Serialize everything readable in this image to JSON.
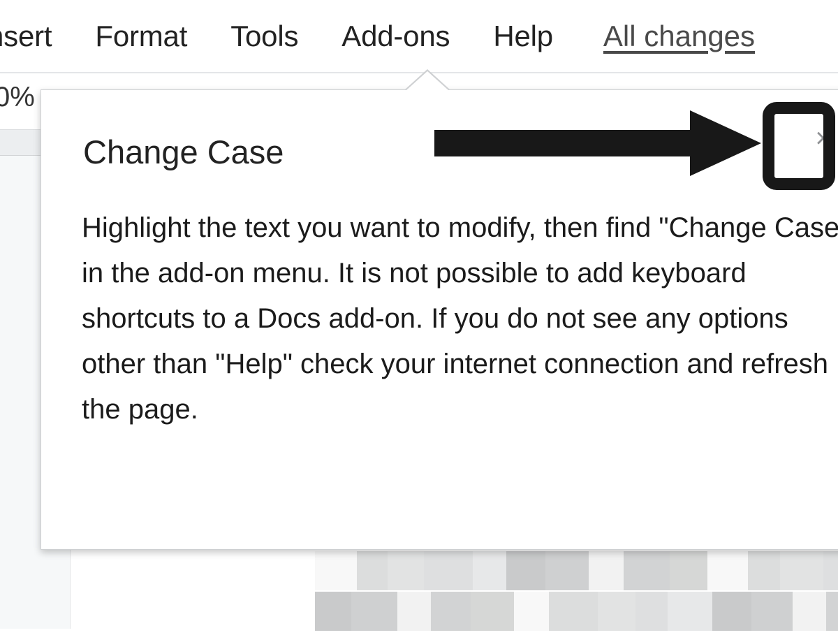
{
  "app": {
    "menu_bar": {
      "items": [
        {
          "label": "nsert",
          "name": "menu-insert"
        },
        {
          "label": "Format",
          "name": "menu-format"
        },
        {
          "label": "Tools",
          "name": "menu-tools"
        },
        {
          "label": "Add-ons",
          "name": "menu-addons"
        },
        {
          "label": "Help",
          "name": "menu-help"
        }
      ],
      "save_status": "All changes"
    },
    "toolbar": {
      "zoom_level": "0%"
    }
  },
  "dialog": {
    "title": "Change Case",
    "body": "Highlight the text you want to modify, then find \"Change Case\" in the add-on menu. It is not possible to add keyboard shortcuts to a Docs add-on. If you do not see any options other than \"Help\" check your internet connection and refresh the page.",
    "close_icon": "×"
  },
  "annotation": {
    "arrow_color": "#181818",
    "highlight_color": "#181818"
  },
  "colors": {
    "menu_text": "#222222",
    "link_text": "#4a4a4a",
    "dialog_text": "#1b1b1b",
    "close_icon": "#8f9194",
    "canvas_bg": "#f6f8f9",
    "ruler_bg": "#eceef0"
  }
}
